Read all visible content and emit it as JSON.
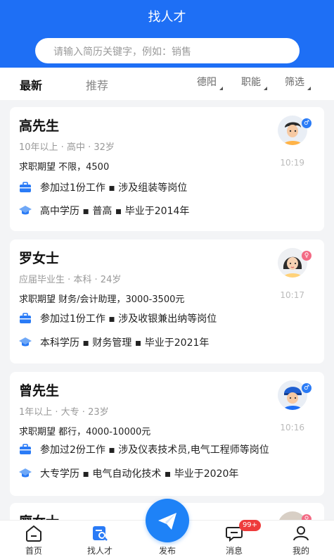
{
  "header": {
    "title": "找人才"
  },
  "search": {
    "placeholder": "请输入简历关键字，例如：销售"
  },
  "tabs": {
    "latest": "最新",
    "recommended": "推荐"
  },
  "filters": {
    "city": "德阳",
    "function": "职能",
    "filter": "筛选"
  },
  "cards": [
    {
      "name": "高先生",
      "meta": "10年以上 · 高中 · 32岁",
      "expectation": "求职期望 不限，4500",
      "work": "参加过1份工作 ▪ 涉及组装等岗位",
      "education": "高中学历 ▪ 普高 ▪ 毕业于2014年",
      "time": "10:19",
      "gender": "male"
    },
    {
      "name": "罗女士",
      "meta": "应届毕业生 · 本科 · 24岁",
      "expectation": "求职期望 财务/会计助理，3000-3500元",
      "work": "参加过1份工作 ▪ 涉及收银兼出纳等岗位",
      "education": "本科学历 ▪ 财务管理 ▪ 毕业于2021年",
      "time": "10:17",
      "gender": "female"
    },
    {
      "name": "曾先生",
      "meta": "1年以上 · 大专 · 23岁",
      "expectation": "求职期望 都行，4000-10000元",
      "work": "参加过2份工作 ▪ 涉及仪表技术员,电气工程师等岗位",
      "education": "大专学历 ▪ 电气自动化技术 ▪ 毕业于2020年",
      "time": "10:16",
      "gender": "male"
    },
    {
      "name": "廖女士"
    }
  ],
  "bottom_nav": {
    "home": "首页",
    "find_talent": "找人才",
    "publish": "发布",
    "messages": "消息",
    "mine": "我的",
    "badge": "99+"
  },
  "colors": {
    "brand": "#1e6ff5",
    "accent_blue": "#2a7bf6",
    "female": "#f36a84",
    "badge": "#ee3b3b"
  }
}
